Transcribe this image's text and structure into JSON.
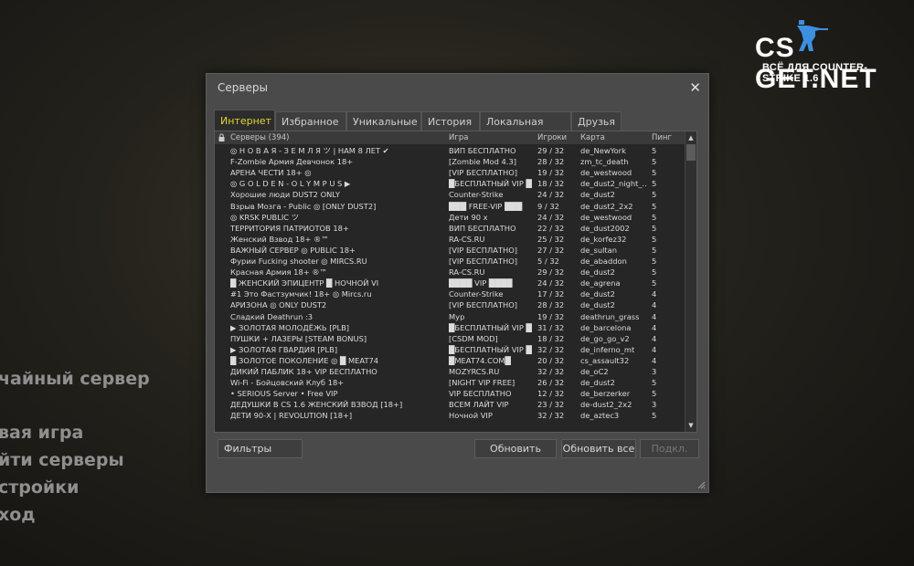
{
  "background_menu": [
    {
      "label": "чайный сервер"
    },
    {
      "label": "вая игра"
    },
    {
      "label": "йти серверы"
    },
    {
      "label": "стройки"
    },
    {
      "label": "ход"
    }
  ],
  "logo": {
    "brand": "CS GET.NET",
    "tagline": "ВСЁ ДЛЯ COUNTER-STRIKE 1.6"
  },
  "dialog": {
    "title": "Серверы",
    "close_icon": "close-icon",
    "tabs": [
      {
        "label": "Интернет",
        "active": true
      },
      {
        "label": "Избранное"
      },
      {
        "label": "Уникальные"
      },
      {
        "label": "История"
      },
      {
        "label": "Локальная сеть"
      },
      {
        "label": "Друзья"
      }
    ],
    "columns": {
      "lock": "lock-icon",
      "servers": "Серверы (394)",
      "game": "Игра",
      "players": "Игроки",
      "map": "Карта",
      "ping": "Пинг"
    },
    "rows": [
      {
        "name": "◎ Н О В А Я - З Е М Л Я ツ | НАМ 8 ЛЕТ ✔",
        "game": "ВИП БЕСПЛАТНО",
        "players": "29 / 32",
        "map": "de_NewYork",
        "ping": "5"
      },
      {
        "name": "F-Zombie Армия Девчонок 18+",
        "game": "[Zombie Mod 4.3]",
        "players": "28 / 32",
        "map": "zm_tc_death",
        "ping": "5"
      },
      {
        "name": "АРЕНА ЧЕСТИ 18+ ◎",
        "game": "[VIP БЕСПЛАТНО]",
        "players": "19 / 32",
        "map": "de_westwood",
        "ping": "5"
      },
      {
        "name": "◎ G O L D E N - O L Y M P U S ▶",
        "game": "█БЕСПЛАТНЫЙ VIP █",
        "players": "18 / 32",
        "map": "de_dust2_night_...",
        "ping": "5"
      },
      {
        "name": "Хорошие люди DUST2 ONLY",
        "game": "Counter-Strike",
        "players": "24 / 32",
        "map": "de_dust2",
        "ping": "5"
      },
      {
        "name": "Взрыв Мозга - Public ◎ [ONLY DUST2]",
        "game": "███ FREE-VIP ███",
        "players": "9 / 32",
        "map": "de_dust2_2x2",
        "ping": "5"
      },
      {
        "name": "◎ KRSK PUBLIC ツ",
        "game": "Дети 90 х",
        "players": "24 / 32",
        "map": "de_westwood",
        "ping": "5"
      },
      {
        "name": "ТЕРРИТОРИЯ ПАТРИОТОВ 18+",
        "game": "ВИП БЕСПЛАТНО",
        "players": "22 / 32",
        "map": "de_dust2002",
        "ping": "5"
      },
      {
        "name": "Женский Взвод 18+ ®™",
        "game": "RA-CS.RU",
        "players": "25 / 32",
        "map": "de_korfez32",
        "ping": "5"
      },
      {
        "name": "ВАЖНЫЙ СЕРВЕР ◎ PUBLIC 18+",
        "game": "[VIP БЕСПЛАТНО]",
        "players": "27 / 32",
        "map": "de_sultan",
        "ping": "5"
      },
      {
        "name": "Фурии Fucking shooter ◎ MIRCS.RU",
        "game": "[VIP БЕСПЛАТНО]",
        "players": "5 / 32",
        "map": "de_abaddon",
        "ping": "5"
      },
      {
        "name": "Красная Армия 18+ ®™",
        "game": "RA-CS.RU",
        "players": "29 / 32",
        "map": "de_dust2",
        "ping": "5"
      },
      {
        "name": "█ ЖЕНСКИЙ ЭПИЦЕНТР █ НОЧНОЙ VI",
        "game": "████ VIP ████",
        "players": "24 / 32",
        "map": "de_agrena",
        "ping": "5"
      },
      {
        "name": "#1 Это Фастзумчик! 18+ ◎ Mircs.ru",
        "game": "Counter-Strike",
        "players": "17 / 32",
        "map": "de_dust2",
        "ping": "4"
      },
      {
        "name": "АРИЗОНА ◎ ONLY DUST2",
        "game": "[VIP БЕСПЛАТНО]",
        "players": "28 / 32",
        "map": "de_dust2",
        "ping": "4"
      },
      {
        "name": "Сладкий Deathrun :3",
        "game": "Мур",
        "players": "19 / 32",
        "map": "deathrun_grass",
        "ping": "4"
      },
      {
        "name": "▶ ЗОЛОТАЯ МОЛОДЁЖЬ [PLB]",
        "game": "█БЕСПЛАТНЫЙ VIP █",
        "players": "31 / 32",
        "map": "de_barcelona",
        "ping": "4"
      },
      {
        "name": "ПУШКИ + ЛАЗЕРЫ [STEAM BONUS]",
        "game": "[CSDM MOD]",
        "players": "18 / 32",
        "map": "de_go_go_v2",
        "ping": "4"
      },
      {
        "name": "▶ ЗОЛОТАЯ ГВАРДИЯ [PLB]",
        "game": "█БЕСПЛАТНЫЙ VIP █",
        "players": "32 / 32",
        "map": "de_inferno_mt",
        "ping": "4"
      },
      {
        "name": "█ ЗОЛОТОЕ ПОКОЛЕНИЕ ◎ █ MEAT74",
        "game": "█MEAT74.COM█",
        "players": "20 / 32",
        "map": "cs_assault32",
        "ping": "4"
      },
      {
        "name": "ДИКИЙ ПАБЛИК 18+ VIP БЕСПЛАТНО",
        "game": "MOZYRCS.RU",
        "players": "32 / 32",
        "map": "de_oC2",
        "ping": "3"
      },
      {
        "name": "Wi-Fi - Бойцовский Клуб 18+",
        "game": "[NIGHT VIP FREE]",
        "players": "26 / 32",
        "map": "de_dust2",
        "ping": "5"
      },
      {
        "name": "• SERIOUS Server • Free VIP",
        "game": "VIP БЕСПЛАТНО",
        "players": "12 / 32",
        "map": "de_berzerker",
        "ping": "5"
      },
      {
        "name": "ДЕДУШКИ В CS 1.6 ЖЕНСКИЙ ВЗВОД [18+]",
        "game": "ВСЕМ ЛАЙТ VIP",
        "players": "23 / 32",
        "map": "de-dust2_2x2",
        "ping": "3"
      },
      {
        "name": "ДЕТИ 90-Х | REVOLUTION [18+]",
        "game": "Ночной VIP",
        "players": "32 / 32",
        "map": "de_aztec3",
        "ping": "5"
      }
    ],
    "buttons": {
      "filters": "Фильтры",
      "refresh": "Обновить",
      "refresh_all": "Обновить все",
      "connect": "Подкл."
    }
  }
}
